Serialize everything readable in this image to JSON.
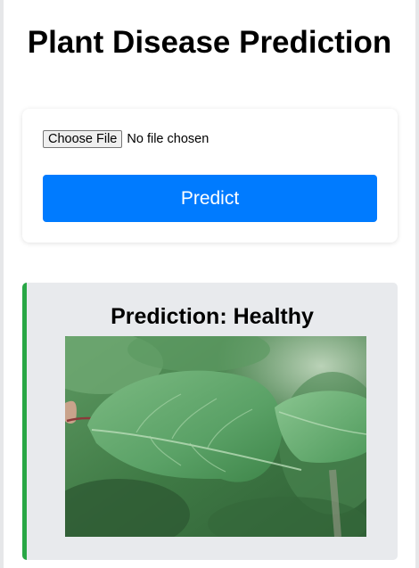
{
  "page": {
    "title": "Plant Disease Prediction"
  },
  "upload": {
    "choose_file_label": "Choose File",
    "file_status": "No file chosen",
    "predict_label": "Predict"
  },
  "result": {
    "title": "Prediction: Healthy",
    "image_description": "leaf-photo"
  },
  "colors": {
    "predict_button": "#007bff",
    "result_accent": "#28a745",
    "result_background": "#e8eaed"
  }
}
